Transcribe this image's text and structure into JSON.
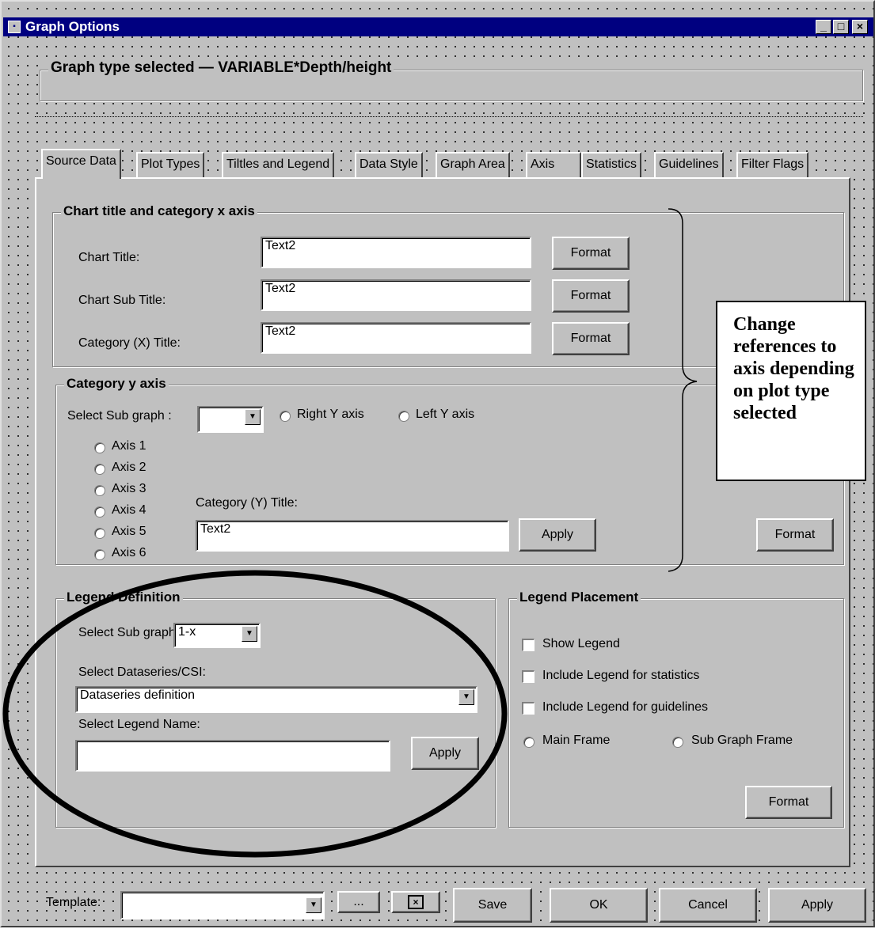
{
  "window": {
    "title": "Graph Options"
  },
  "header": {
    "graph_type_label": "Graph type selected",
    "graph_type_value": "VARIABLE*Depth/height"
  },
  "tabs": [
    "Source Data",
    "Plot Types",
    "Tiltles and Legend",
    "Data Style",
    "Graph Area",
    "Axis",
    "Statistics",
    "Guidelines",
    "Filter Flags"
  ],
  "chart_title_group": {
    "legend": "Chart title and category x axis",
    "rows": [
      {
        "label": "Chart Title:",
        "value": "Text2",
        "button": "Format"
      },
      {
        "label": "Chart Sub Title:",
        "value": "Text2",
        "button": "Format"
      },
      {
        "label": "Category (X) Title:",
        "value": "Text2",
        "button": "Format"
      }
    ]
  },
  "y_axis_group": {
    "legend": "Category y axis",
    "select_sub_graph_label": "Select Sub graph :",
    "select_sub_graph_value": "",
    "right_y": "Right Y axis",
    "left_y": "Left Y axis",
    "axes": [
      "Axis 1",
      "Axis 2",
      "Axis 3",
      "Axis 4",
      "Axis 5",
      "Axis 6"
    ],
    "y_title_label": "Category (Y) Title:",
    "y_title_value": "Text2",
    "apply": "Apply",
    "format": "Format"
  },
  "annotation": {
    "text": "Change references to axis depending on plot type selected"
  },
  "legend_definition": {
    "legend": "Legend Definition",
    "select_sub_graph_label": "Select Sub graph:",
    "select_sub_graph_value": "1-x",
    "dataseries_label": "Select Dataseries/CSI:",
    "dataseries_value": "Dataseries definition",
    "legend_name_label": "Select Legend Name:",
    "legend_name_value": "",
    "apply": "Apply"
  },
  "legend_placement": {
    "legend": "Legend Placement",
    "show_legend": "Show Legend",
    "include_statistics": "Include Legend for statistics",
    "include_guidelines": "Include Legend for guidelines",
    "main_frame": "Main Frame",
    "sub_graph_frame": "Sub Graph Frame",
    "format": "Format"
  },
  "bottom": {
    "template_label": "Template:",
    "template_value": "",
    "browse": "...",
    "save": "Save",
    "ok": "OK",
    "cancel": "Cancel",
    "apply": "Apply"
  }
}
